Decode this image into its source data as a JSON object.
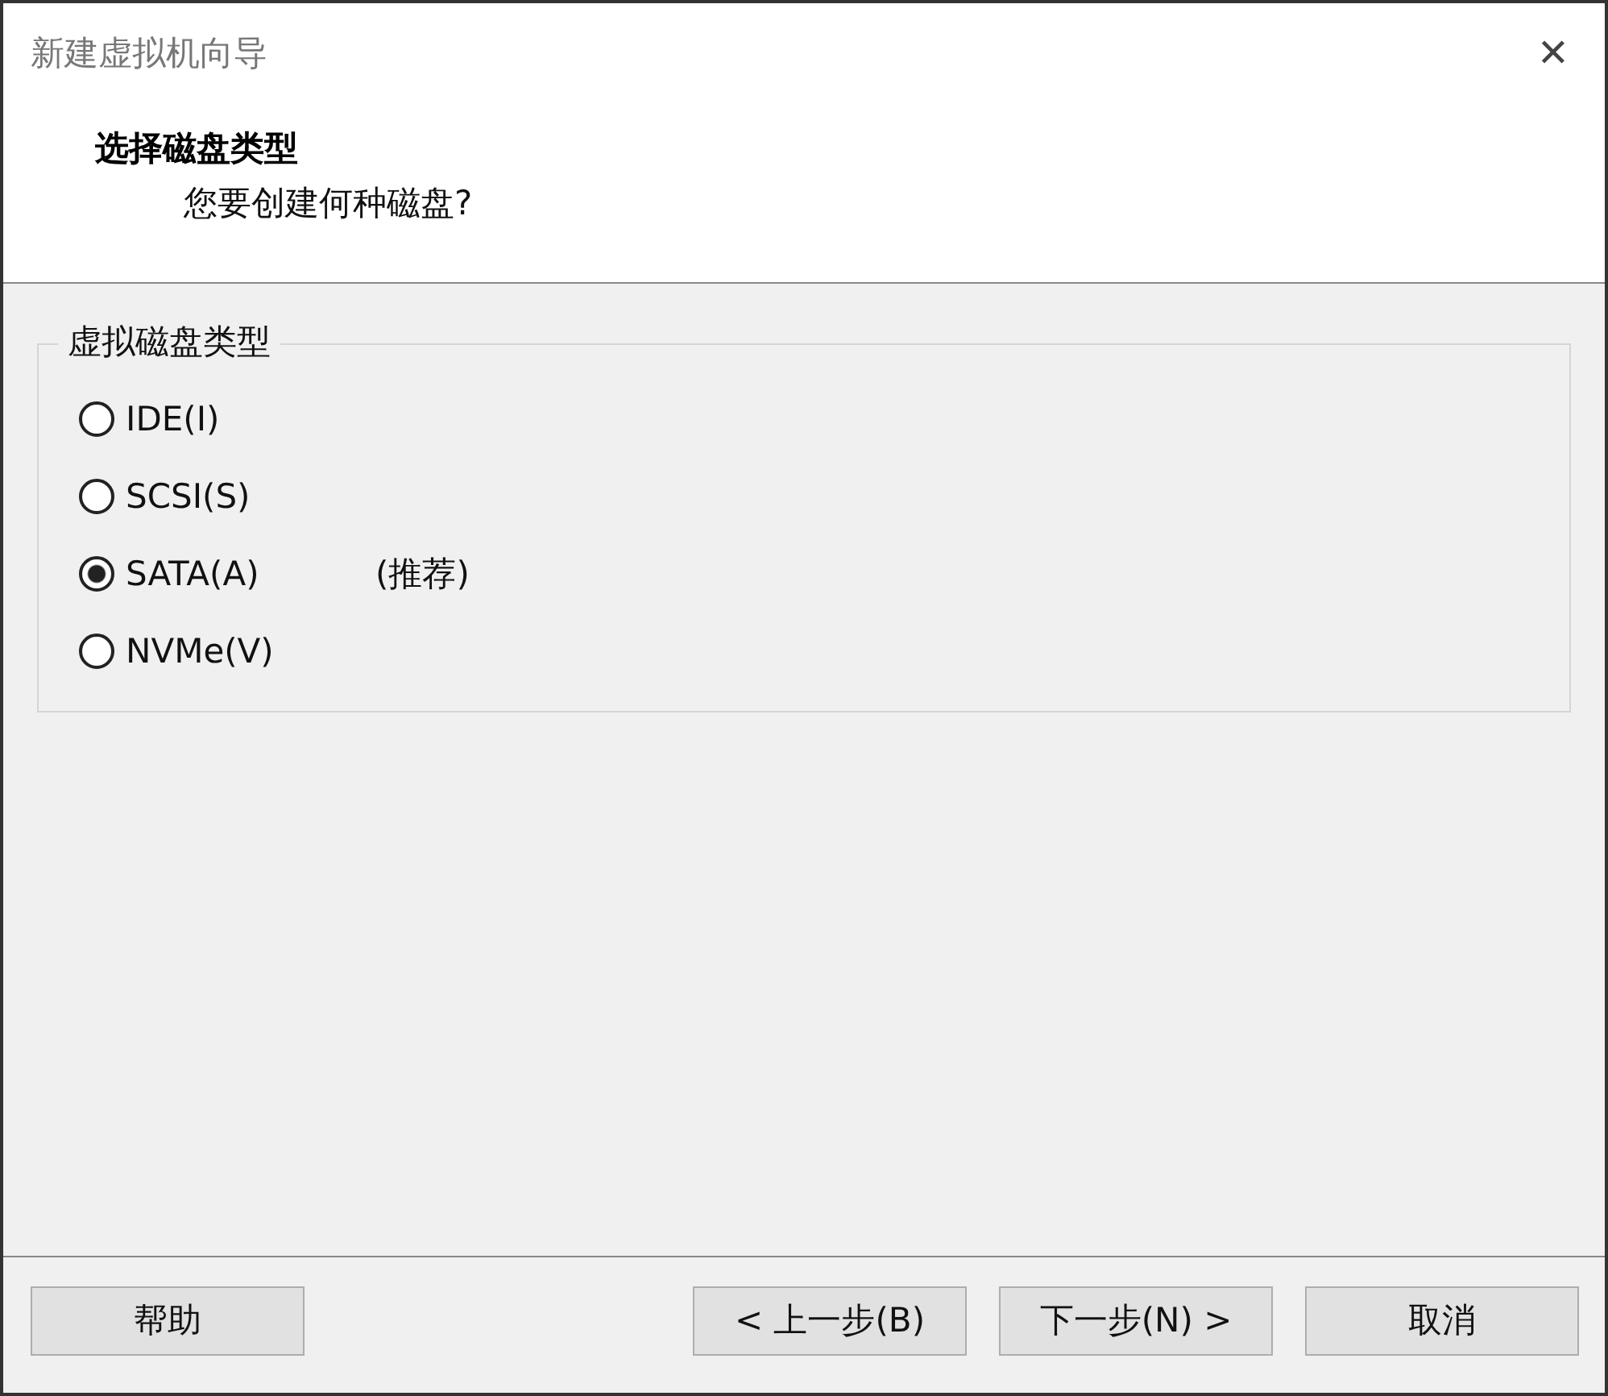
{
  "window": {
    "title": "新建虚拟机向导",
    "close": "✕"
  },
  "header": {
    "heading": "选择磁盘类型",
    "subheading": "您要创建何种磁盘?"
  },
  "group": {
    "legend": "虚拟磁盘类型",
    "options": [
      {
        "label": "IDE(I)",
        "selected": false
      },
      {
        "label": "SCSI(S)",
        "selected": false
      },
      {
        "label": "SATA(A)",
        "selected": true,
        "note": "(推荐)"
      },
      {
        "label": "NVMe(V)",
        "selected": false
      }
    ]
  },
  "buttons": [
    {
      "label": "帮助",
      "kind": "left"
    },
    {
      "label": "< 上一步(B)",
      "kind": "right"
    },
    {
      "label": "下一步(N) >",
      "kind": "right"
    },
    {
      "label": "取消",
      "kind": "gap"
    }
  ]
}
